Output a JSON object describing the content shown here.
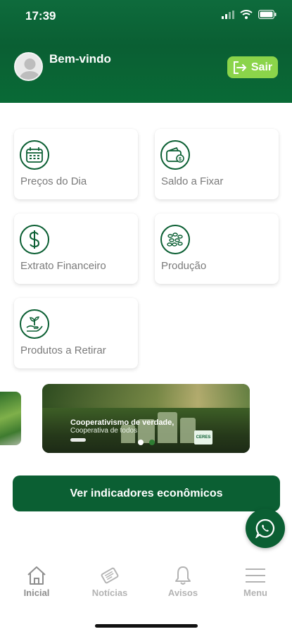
{
  "status_bar": {
    "time": "17:39"
  },
  "header": {
    "welcome": "Bem-vindo",
    "logout_label": "Sair"
  },
  "menu_cards": [
    {
      "label": "Preços do Dia",
      "icon": "calendar-icon"
    },
    {
      "label": "Saldo a Fixar",
      "icon": "wallet-icon"
    },
    {
      "label": "Extrato Financeiro",
      "icon": "dollar-icon"
    },
    {
      "label": "Produção",
      "icon": "grain-icon"
    },
    {
      "label": "Produtos a Retirar",
      "icon": "plant-hand-icon"
    }
  ],
  "banner": {
    "title": "Cooperativismo de verdade,",
    "subtitle": "Cooperativa de todos",
    "logo_text": "CERES",
    "active_slide": 1,
    "slide_count": 2
  },
  "cta": {
    "label": "Ver indicadores econômicos"
  },
  "whatsapp": {
    "icon": "whatsapp-icon"
  },
  "tabbar": {
    "items": [
      {
        "label": "Inicial",
        "icon": "home-icon",
        "active": true
      },
      {
        "label": "Notícias",
        "icon": "newspaper-icon",
        "active": false
      },
      {
        "label": "Avisos",
        "icon": "bell-icon",
        "active": false
      },
      {
        "label": "Menu",
        "icon": "hamburger-icon",
        "active": false
      }
    ]
  },
  "colors": {
    "primary": "#0b5f33",
    "accent": "#8bd44a",
    "muted_text": "#7a7a7a"
  }
}
